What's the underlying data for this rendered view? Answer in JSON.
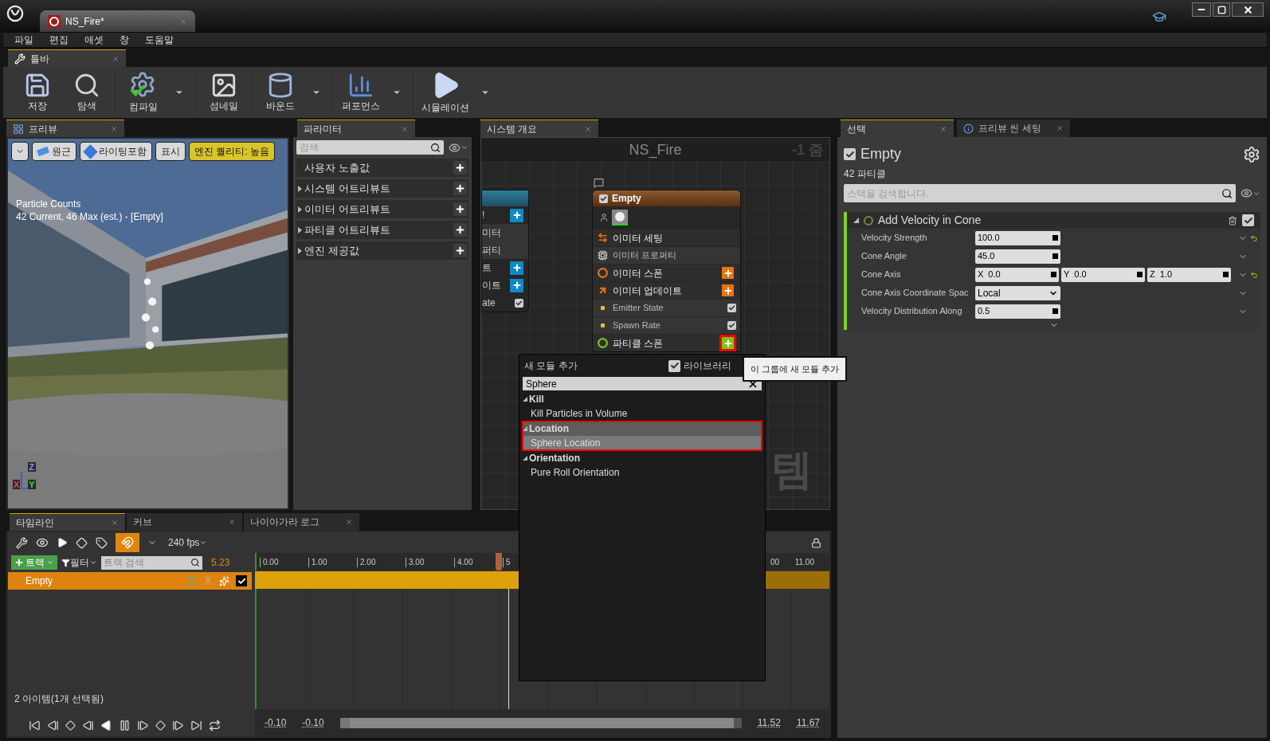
{
  "window": {
    "tab_title": "NS_Fire*"
  },
  "menu": [
    "파일",
    "편집",
    "애셋",
    "창",
    "도움말"
  ],
  "toolbar": {
    "tab": "툴바",
    "groups": [
      [
        {
          "label": "저장",
          "kind": "save",
          "dropdown": false
        },
        {
          "label": "탐색",
          "kind": "browse",
          "dropdown": false
        }
      ],
      [
        {
          "label": "컴파일",
          "kind": "compile",
          "dropdown": true
        }
      ],
      [
        {
          "label": "섬네일",
          "kind": "thumbnail",
          "dropdown": false
        }
      ],
      [
        {
          "label": "바운드",
          "kind": "bounds",
          "dropdown": true
        }
      ],
      [
        {
          "label": "퍼포먼스",
          "kind": "performance",
          "dropdown": true
        }
      ],
      [
        {
          "label": "시뮬레이션",
          "kind": "simulate",
          "dropdown": true
        }
      ]
    ]
  },
  "preview": {
    "tab": "프리뷰",
    "buttons": [
      {
        "label": "원근",
        "kind": "perspective"
      },
      {
        "label": "라이팅포함",
        "kind": "lit"
      },
      {
        "label": "표시",
        "kind": "plain"
      },
      {
        "label": "엔진 퀄리티: 높음",
        "kind": "warning"
      }
    ],
    "overlay": [
      "Particle Counts",
      "42 Current, 46 Max (est.) - [Empty]"
    ],
    "axes": [
      "Z",
      "X",
      "Y"
    ]
  },
  "parameters": {
    "tab": "파라미터",
    "search_placeholder": "검색",
    "categories": [
      {
        "label": "사용자 노출값",
        "expandable": false
      },
      {
        "label": "시스템 어트리뷰트",
        "expandable": true
      },
      {
        "label": "이미터 어트리뷰트",
        "expandable": true
      },
      {
        "label": "파티클 어트리뷰트",
        "expandable": true
      },
      {
        "label": "엔진 제공값",
        "expandable": true
      }
    ]
  },
  "graph": {
    "tab": "시스템 개요",
    "title": "NS_Fire",
    "zoom": "-1 줌",
    "background_label": "템",
    "side_node": {
      "rows": [
        {
          "label": "!",
          "kind": "stage"
        },
        {
          "label": "미터",
          "kind": "property"
        },
        {
          "label": "퍼티",
          "kind": "property"
        },
        {
          "label": "트",
          "kind": "stage"
        },
        {
          "label": "이트",
          "kind": "stage"
        },
        {
          "label": "ate",
          "kind": "module",
          "checked": true
        }
      ]
    },
    "node": {
      "title": "Empty",
      "enabled": true,
      "rows": [
        {
          "label": "이미터 세팅",
          "kind": "settings",
          "color": "#e8730f"
        },
        {
          "label": "이미터 프로퍼티",
          "kind": "properties"
        },
        {
          "label": "이미터 스폰",
          "kind": "spawn",
          "color": "#e8730f",
          "highlighted": false
        },
        {
          "label": "이미터 업데이트",
          "kind": "update",
          "color": "#e8730f",
          "highlighted": false
        },
        {
          "label": "Emitter State",
          "kind": "module",
          "checked": true
        },
        {
          "label": "Spawn Rate",
          "kind": "module",
          "checked": true
        },
        {
          "label": "파티클 스폰",
          "kind": "spawn",
          "color": "#7ec21c",
          "highlighted": true
        }
      ]
    }
  },
  "add_module_menu": {
    "title": "새 모듈 추가",
    "library": {
      "label": "라이브러리",
      "checked": true
    },
    "search": "Sphere",
    "groups": [
      {
        "label": "Kill",
        "selected": false,
        "items": [
          {
            "label": "Kill Particles in Volume",
            "selected": false
          }
        ]
      },
      {
        "label": "Location",
        "selected": true,
        "items": [
          {
            "label": "Sphere Location",
            "selected": true
          }
        ]
      },
      {
        "label": "Orientation",
        "selected": false,
        "items": [
          {
            "label": "Pure Roll Orientation",
            "selected": false
          }
        ]
      }
    ],
    "tooltip": "이 그룹에 새 모듈 추가"
  },
  "details": {
    "tabs": [
      {
        "label": "선택",
        "selected": true
      },
      {
        "label": "프리뷰 씬 세팅",
        "selected": false
      }
    ],
    "emitter": {
      "name": "Empty",
      "enabled": true
    },
    "particle_count": "42 파티클",
    "search_placeholder": "스택을 검색합니다.",
    "module": {
      "title": "Add Velocity in Cone",
      "enabled": true,
      "expanded": true,
      "params": [
        {
          "name": "Velocity Strength",
          "kind": "number",
          "values": [
            {
              "value": "100.0"
            }
          ],
          "modified": true
        },
        {
          "name": "Cone Angle",
          "kind": "number",
          "values": [
            {
              "value": "45.0"
            }
          ],
          "modified": false
        },
        {
          "name": "Cone Axis",
          "kind": "vector",
          "values": [
            {
              "axis": "X",
              "value": "0.0"
            },
            {
              "axis": "Y",
              "value": "0.0"
            },
            {
              "axis": "Z",
              "value": "1.0"
            }
          ],
          "modified": true
        },
        {
          "name": "Cone Axis Coordinate Spac",
          "kind": "enum",
          "values": [
            {
              "value": "Local"
            }
          ],
          "modified": false
        },
        {
          "name": "Velocity Distribution Along",
          "kind": "number",
          "values": [
            {
              "value": "0.5"
            }
          ],
          "modified": false
        }
      ]
    }
  },
  "timeline": {
    "tabs": [
      {
        "label": "타임라인",
        "selected": true
      },
      {
        "label": "커브",
        "selected": false
      },
      {
        "label": "나이아가라 로그",
        "selected": false
      }
    ],
    "snap": true,
    "fps": "240 fps",
    "track_button": "트랙",
    "filter": "필터",
    "search_placeholder": "트랙 검색",
    "current_time": "5.23",
    "tracks": [
      {
        "label": "Empty",
        "selected": true,
        "enabled": true
      }
    ],
    "ticks": [
      "0.00",
      "1.00",
      "2.00",
      "3.00",
      "4.00",
      "5"
    ],
    "ticks_after": [
      "00",
      "11.00"
    ],
    "status": "2 아이템(1개 선택됨)",
    "view_start": "-0.10",
    "play_start": "-0.10",
    "play_end": "11.52",
    "view_end": "11.67"
  }
}
